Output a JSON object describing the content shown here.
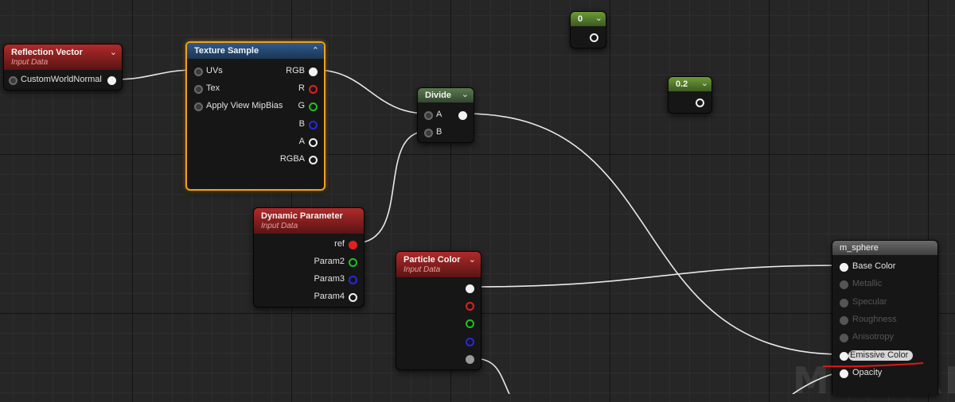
{
  "watermark": "MATERIAL",
  "nodes": {
    "reflection_vector": {
      "title": "Reflection Vector",
      "subtitle": "Input Data",
      "output": "CustomWorldNormal"
    },
    "texture_sample": {
      "title": "Texture Sample",
      "inputs": [
        "UVs",
        "Tex",
        "Apply View MipBias"
      ],
      "outputs": [
        "RGB",
        "R",
        "G",
        "B",
        "A",
        "RGBA"
      ]
    },
    "divide": {
      "title": "Divide",
      "inputs": [
        "A",
        "B"
      ]
    },
    "const_0": {
      "value": "0"
    },
    "const_02": {
      "value": "0.2"
    },
    "dynamic_parameter": {
      "title": "Dynamic Parameter",
      "subtitle": "Input Data",
      "outputs": [
        "ref",
        "Param2",
        "Param3",
        "Param4"
      ]
    },
    "particle_color": {
      "title": "Particle Color",
      "subtitle": "Input Data"
    },
    "material_output": {
      "title": "m_sphere",
      "inputs": [
        "Base Color",
        "Metallic",
        "Specular",
        "Roughness",
        "Anisotropy",
        "Emissive Color",
        "Opacity"
      ]
    }
  },
  "colors": {
    "selection": "#f0a020",
    "annotation": "#e01818",
    "wire": "#e8e8e8"
  }
}
